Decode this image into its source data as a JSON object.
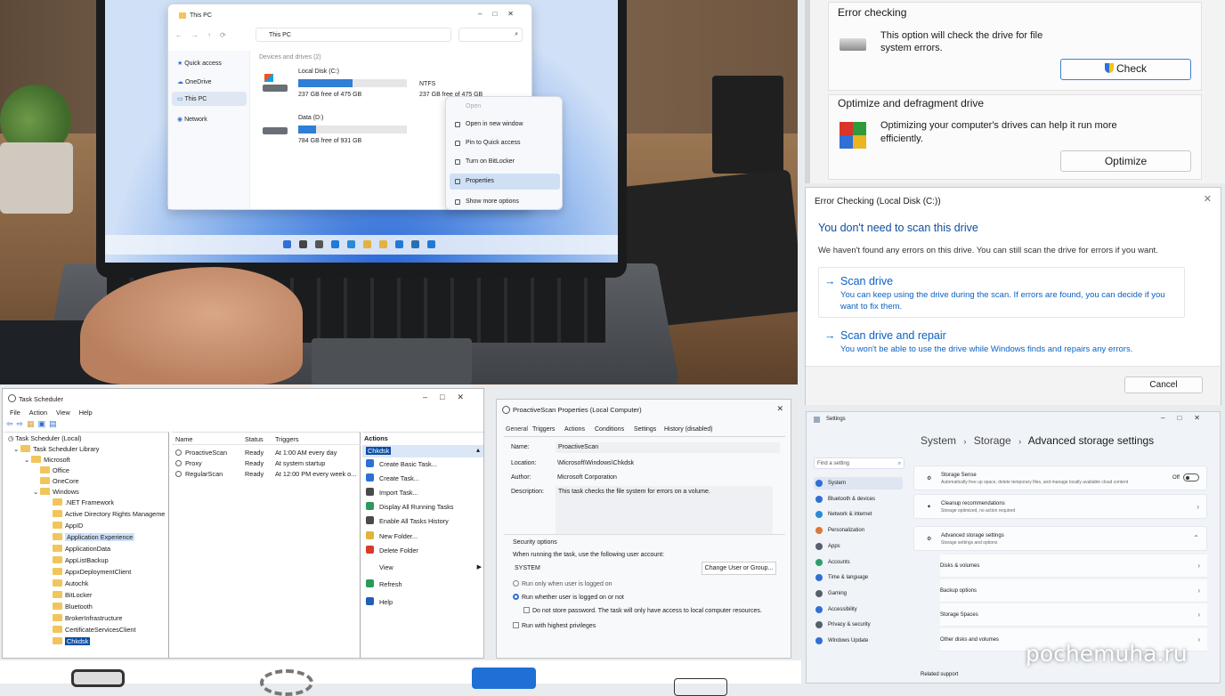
{
  "explorer": {
    "title": "This PC",
    "address": "This PC",
    "nav_items": [
      "Quick access",
      "OneDrive",
      "This PC",
      "Network"
    ],
    "section": "Devices and drives (2)",
    "drives": [
      {
        "name": "Local Disk (C:)",
        "free": "237 GB free of 475 GB",
        "fill": 0.5
      },
      {
        "name": "Data (D:)",
        "free": "784 GB free of 931 GB",
        "fill": 0.16
      }
    ],
    "detail_fs": "NTFS",
    "detail_free": "237 GB free of 475 GB"
  },
  "context_menu": {
    "items": [
      "Open",
      "Open in new window",
      "Pin to Quick access",
      "Turn on BitLocker",
      "Properties",
      "Show more options"
    ]
  },
  "disk_properties": {
    "error_checking": {
      "heading": "Error checking",
      "text": "This option will check the drive for file system errors.",
      "button": "Check"
    },
    "optimize": {
      "heading": "Optimize and defragment drive",
      "text": "Optimizing your computer's drives can help it run more efficiently.",
      "button": "Optimize"
    }
  },
  "error_dialog": {
    "title": "Error Checking (Local Disk (C:))",
    "heading": "You don't need to scan this drive",
    "message": "We haven't found any errors on this drive. You can still scan the drive for errors if you want.",
    "options": [
      {
        "title": "Scan drive",
        "desc": "You can keep using the drive during the scan. If errors are found, you can decide if you want to fix them."
      },
      {
        "title": "Scan drive and repair",
        "desc": "You won't be able to use the drive while Windows finds and repairs any errors."
      }
    ],
    "cancel": "Cancel"
  },
  "task_scheduler": {
    "title": "Task Scheduler",
    "menu": [
      "File",
      "Action",
      "View",
      "Help"
    ],
    "tree": {
      "root": "Task Scheduler (Local)",
      "library": "Task Scheduler Library",
      "microsoft": "Microsoft",
      "office": "Office",
      "onecore": "OneCore",
      "windows": "Windows",
      "folders": [
        ".NET Framework",
        "Active Directory Rights Manageme",
        "AppID",
        "Application Experience",
        "ApplicationData",
        "AppListBackup",
        "AppxDeploymentClient",
        "Autochk",
        "BitLocker",
        "Bluetooth",
        "BrokerInfrastructure",
        "CertificateServicesClient",
        "Chkdsk"
      ]
    },
    "columns": [
      "Name",
      "Status",
      "Triggers"
    ],
    "tasks": [
      {
        "name": "ProactiveScan",
        "status": "Ready",
        "trigger": "At 1:00 AM every day"
      },
      {
        "name": "Proxy",
        "status": "Ready",
        "trigger": "At system startup"
      },
      {
        "name": "RegularScan",
        "status": "Ready",
        "trigger": "At 12:00 PM every week o..."
      }
    ],
    "actions_header": "Actions",
    "actions_selected": "Chkdsk",
    "actions": [
      "Create Basic Task...",
      "Create Task...",
      "Import Task...",
      "Display All Running Tasks",
      "Enable All Tasks History",
      "New Folder...",
      "Delete Folder",
      "View",
      "Refresh",
      "Help"
    ]
  },
  "task_properties": {
    "title": "ProactiveScan Properties (Local Computer)",
    "tabs": [
      "General",
      "Triggers",
      "Actions",
      "Conditions",
      "Settings",
      "History (disabled)"
    ],
    "name_label": "Name:",
    "name": "ProactiveScan",
    "location_label": "Location:",
    "location": "\\Microsoft\\Windows\\Chkdsk",
    "author_label": "Author:",
    "author": "Microsoft Corporation",
    "description_label": "Description:",
    "description": "This task checks the file system for errors on a volume.",
    "security_heading": "Security options",
    "account_prompt": "When running the task, use the following user account:",
    "account": "SYSTEM",
    "change_button": "Change User or Group...",
    "radio1": "Run only when user is logged on",
    "radio2": "Run whether user is logged on or not",
    "check_nopwd": "Do not store password.  The task will only have access to local computer resources.",
    "check_highest": "Run with highest privileges"
  },
  "settings": {
    "title": "Settings",
    "breadcrumb": [
      "System",
      "Storage",
      "Advanced storage settings"
    ],
    "search_placeholder": "Find a setting",
    "nav": [
      {
        "label": "System",
        "color": "#2f6fd6"
      },
      {
        "label": "Bluetooth & devices",
        "color": "#2f6fd6"
      },
      {
        "label": "Network & internet",
        "color": "#2a8ad8"
      },
      {
        "label": "Personalization",
        "color": "#d9783a"
      },
      {
        "label": "Apps",
        "color": "#56606b"
      },
      {
        "label": "Accounts",
        "color": "#2ea06b"
      },
      {
        "label": "Time & language",
        "color": "#2f6fd6"
      },
      {
        "label": "Gaming",
        "color": "#56606b"
      },
      {
        "label": "Accessibility",
        "color": "#2f6fd6"
      },
      {
        "label": "Privacy & security",
        "color": "#56606b"
      },
      {
        "label": "Windows Update",
        "color": "#2f6fd6"
      }
    ],
    "storage_sense": {
      "title": "Storage Sense",
      "desc": "Automatically free up space, delete temporary files, and manage locally available cloud content",
      "state": "Off"
    },
    "cleanup": {
      "title": "Cleanup recommendations",
      "desc": "Storage optimized, no action required"
    },
    "advanced": {
      "title": "Advanced storage settings",
      "desc": "Storage settings and options"
    },
    "sub_items": [
      "Disks & volumes",
      "Backup options",
      "Storage Spaces",
      "Other disks and volumes"
    ],
    "related": "Related support"
  },
  "watermark": "pochemuha.ru"
}
